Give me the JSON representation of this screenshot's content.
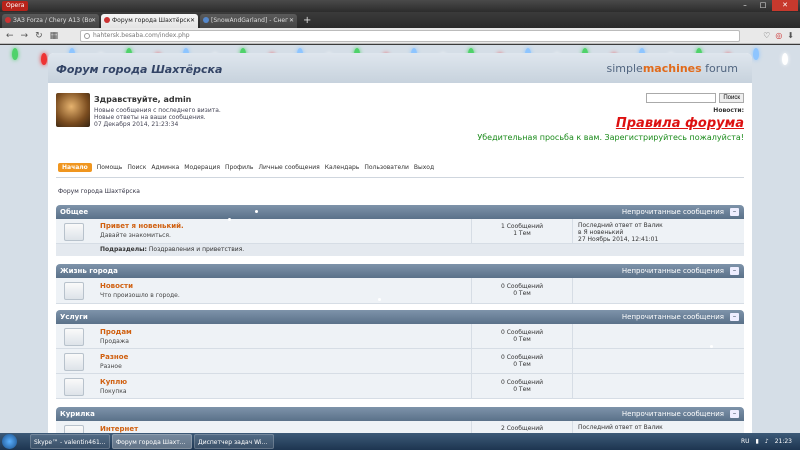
{
  "browser": {
    "menu_label": "Opera",
    "tabs": [
      {
        "label": "ЗАЗ Forza / Chery A13 (Bo"
      },
      {
        "label": "Форум города Шахтёрск"
      },
      {
        "label": "[SnowAndGarland] - Снег"
      }
    ],
    "url": "hahtersk.besaba.com/index.php"
  },
  "forum": {
    "title": "Форум города Шахтёрска",
    "brand_prefix": "simple",
    "brand_highlight": "machines",
    "brand_suffix": " forum",
    "greeting": "Здравствуйте, admin",
    "user_lines": [
      "Новые сообщения с последнего визита.",
      "Новые ответы на ваши сообщения.",
      "07 Декабря 2014, 21:23:34"
    ],
    "search_button": "Поиск",
    "news_label": "Новости:",
    "rules_link": "Правила форума",
    "plea": "Убедительная просьба к вам. Зарегистрируйтесь пожалуйста!",
    "menu": [
      "Начало",
      "Помощь",
      "Поиск",
      "Админка",
      "Модерация",
      "Профиль",
      "Личные сообщения",
      "Календарь",
      "Пользователи",
      "Выход"
    ],
    "breadcrumb": "Форум города Шахтёрска",
    "unread_label": "Непрочитанные сообщения",
    "categories": [
      {
        "name": "Общее"
      },
      {
        "name": "Жизнь города"
      },
      {
        "name": "Услуги"
      },
      {
        "name": "Курилка"
      }
    ],
    "boards": [
      {
        "title": "Привет я новенький.",
        "desc": "Давайте знакомиться.",
        "posts": "1 Сообщений",
        "topics": "1 Тем",
        "lp1": "Последний ответ от Валик",
        "lp2": "в Я новенький",
        "lp3": "27 Ноябрь 2014, 12:41:01"
      },
      {
        "title": "Новости",
        "desc": "Что произошло в городе.",
        "posts": "0 Сообщений",
        "topics": "0 Тем"
      },
      {
        "title": "Продам",
        "desc": "Продажа",
        "posts": "0 Сообщений",
        "topics": "0 Тем"
      },
      {
        "title": "Разное",
        "desc": "Разное",
        "posts": "0 Сообщений",
        "topics": "0 Тем"
      },
      {
        "title": "Куплю",
        "desc": "Покупка",
        "posts": "0 Сообщений",
        "topics": "0 Тем"
      },
      {
        "title": "Интернет",
        "posts": "2 Сообщений",
        "lp1": "Последний ответ от Валик"
      }
    ],
    "subboards_label": "Подразделы:",
    "subboards_value": "Поздравления и приветствия."
  },
  "taskbar": {
    "tasks": [
      "Skype™ - valentin461...",
      "Форум города Шахт...",
      "Диспетчер задач Wi..."
    ],
    "lang": "RU",
    "time": "21:23"
  }
}
